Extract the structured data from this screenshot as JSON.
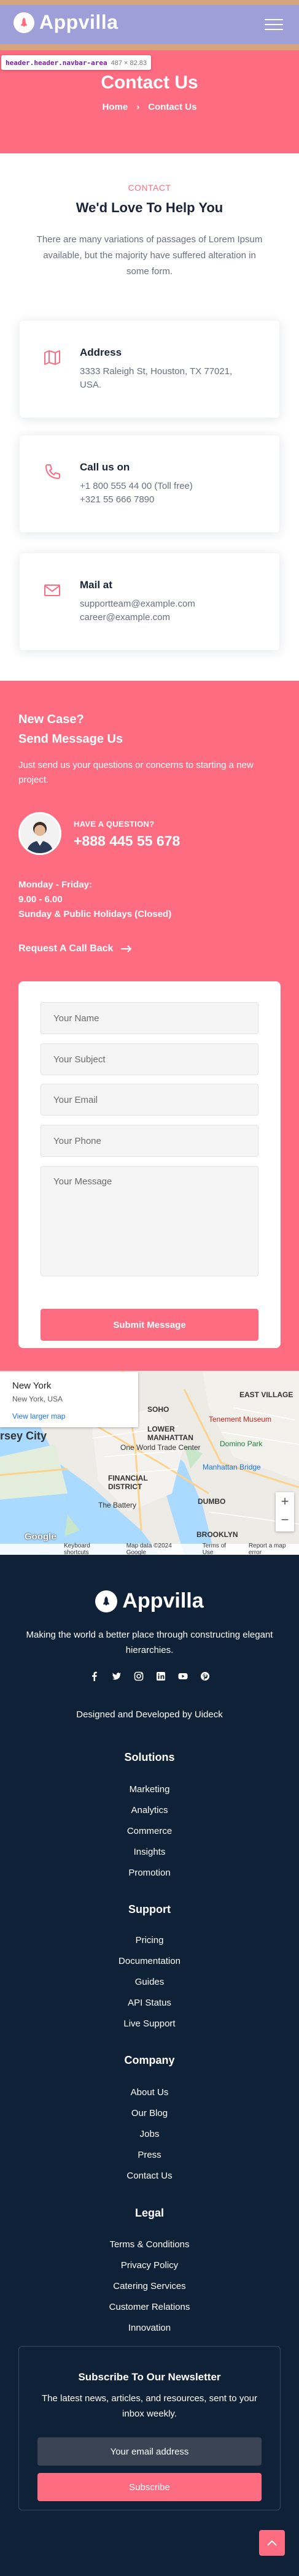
{
  "header": {
    "brand": "Appvilla",
    "inspect_selector": "header.header.navbar-area",
    "inspect_size": "487 × 82.83"
  },
  "hero": {
    "title": "Contact Us",
    "breadcrumb": [
      "Home",
      "Contact Us"
    ]
  },
  "intro": {
    "eyebrow": "CONTACT",
    "title": "We'd Love To Help You",
    "text": "There are many variations of passages of Lorem Ipsum available, but the majority have suffered alteration in some form."
  },
  "cards": [
    {
      "icon": "map-icon",
      "title": "Address",
      "lines": [
        "3333 Raleigh St, Houston, TX 77021,",
        "USA."
      ]
    },
    {
      "icon": "phone-icon",
      "title": "Call us on",
      "lines": [
        "+1 800 555 44 00 (Toll free)",
        "+321 55 666 7890"
      ]
    },
    {
      "icon": "mail-icon",
      "title": "Mail at",
      "lines": [
        "supportteam@example.com",
        "career@example.com"
      ]
    }
  ],
  "form_section": {
    "kicker": "New Case?",
    "title": "Send Message Us",
    "description": "Just send us your questions or concerns to starting a new project.",
    "question_label": "HAVE A QUESTION?",
    "phone": "+888 445 55 678",
    "hours": [
      "Monday - Friday:",
      "9.00 - 6.00",
      "Sunday & Public Holidays (Closed)"
    ],
    "callback": "Request A Call Back",
    "fields": {
      "name": "Your Name",
      "subject": "Your Subject",
      "email": "Your Email",
      "phone": "Your Phone",
      "message": "Your Message"
    },
    "submit": "Submit Message"
  },
  "map": {
    "place": "New York",
    "place_sub": "New York, USA",
    "larger": "View larger map",
    "labels": [
      "SOHO",
      "LOWER MANHATTAN",
      "FINANCIAL DISTRICT",
      "One World Trade Center",
      "The Battery",
      "DUMBO",
      "EAST VILLAGE",
      "Tenement Museum",
      "Domino Park",
      "Manhattan Bridge",
      "BROOKLYN",
      "rsey City",
      "Google"
    ],
    "footer": [
      "Keyboard shortcuts",
      "Map data ©2024 Google",
      "Terms of Use",
      "Report a map error"
    ]
  },
  "footer": {
    "brand": "Appvilla",
    "tagline": "Making the world a better place through constructing elegant hierarchies.",
    "socials": [
      "facebook-icon",
      "twitter-icon",
      "instagram-icon",
      "linkedin-icon",
      "youtube-icon",
      "pinterest-icon"
    ],
    "credit": "Designed and Developed by Uideck",
    "columns": [
      {
        "title": "Solutions",
        "links": [
          "Marketing",
          "Analytics",
          "Commerce",
          "Insights",
          "Promotion"
        ]
      },
      {
        "title": "Support",
        "links": [
          "Pricing",
          "Documentation",
          "Guides",
          "API Status",
          "Live Support"
        ]
      },
      {
        "title": "Company",
        "links": [
          "About Us",
          "Our Blog",
          "Jobs",
          "Press",
          "Contact Us"
        ]
      },
      {
        "title": "Legal",
        "links": [
          "Terms & Conditions",
          "Privacy Policy",
          "Catering Services",
          "Customer Relations",
          "Innovation"
        ]
      }
    ],
    "newsletter": {
      "title": "Subscribe To Our Newsletter",
      "text": "The latest news, articles, and resources, sent to your inbox weekly.",
      "placeholder": "Your email address",
      "button": "Subscribe"
    }
  },
  "colors": {
    "accent": "#fd6c80",
    "dark": "#0f2137",
    "text": "#6a6f7c"
  }
}
